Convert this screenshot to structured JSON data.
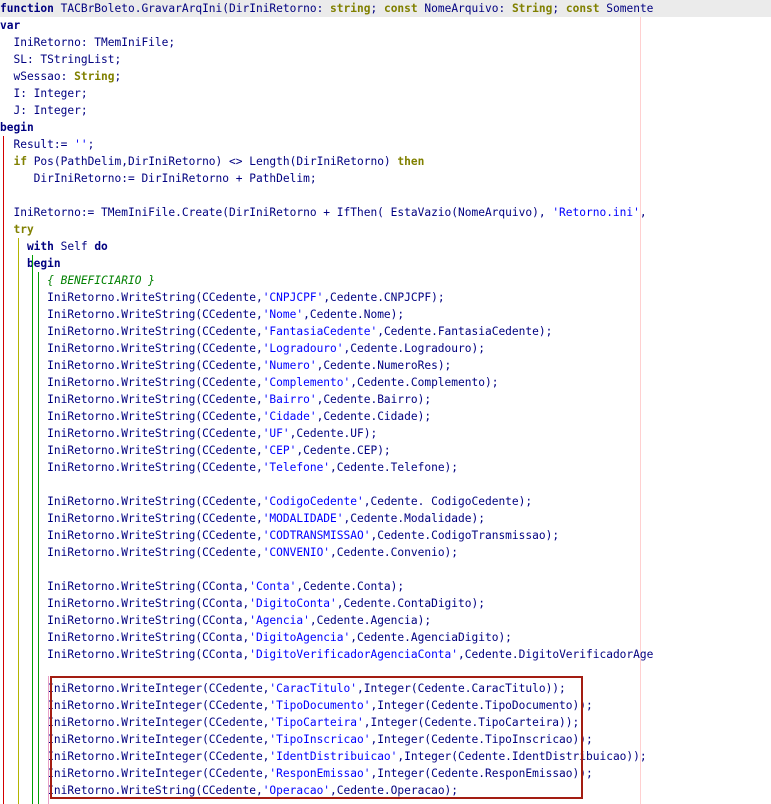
{
  "editor": {
    "lines": [
      {
        "hl": true,
        "tokens": [
          [
            "kw",
            "function"
          ],
          [
            "id",
            " TACBrBoleto.GravarArqIni(DirIniRetorno: "
          ],
          [
            "kw2",
            "string"
          ],
          [
            "id",
            "; "
          ],
          [
            "kw2",
            "const"
          ],
          [
            "id",
            " NomeArquivo: "
          ],
          [
            "kw2",
            "String"
          ],
          [
            "id",
            "; "
          ],
          [
            "kw2",
            "const"
          ],
          [
            "id",
            " Somente"
          ]
        ]
      },
      {
        "tokens": [
          [
            "kw",
            "var"
          ]
        ]
      },
      {
        "tokens": [
          [
            "id",
            "  IniRetorno: TMemIniFile;"
          ]
        ]
      },
      {
        "tokens": [
          [
            "id",
            "  SL: TStringList;"
          ]
        ]
      },
      {
        "tokens": [
          [
            "id",
            "  wSessao: "
          ],
          [
            "kw2",
            "String"
          ],
          [
            "id",
            ";"
          ]
        ]
      },
      {
        "tokens": [
          [
            "id",
            "  I: Integer;"
          ]
        ]
      },
      {
        "tokens": [
          [
            "id",
            "  J: Integer;"
          ]
        ]
      },
      {
        "tokens": [
          [
            "kw",
            "begin"
          ]
        ]
      },
      {
        "tokens": [
          [
            "id",
            "  Result:= "
          ],
          [
            "str",
            "''"
          ],
          [
            "id",
            ";"
          ]
        ]
      },
      {
        "tokens": [
          [
            "kw2",
            "  if"
          ],
          [
            "id",
            " Pos(PathDelim,DirIniRetorno) <> Length(DirIniRetorno) "
          ],
          [
            "kw2",
            "then"
          ]
        ]
      },
      {
        "tokens": [
          [
            "id",
            "     DirIniRetorno:= DirIniRetorno + PathDelim;"
          ]
        ]
      },
      {
        "tokens": [
          [
            "id",
            ""
          ]
        ]
      },
      {
        "tokens": [
          [
            "id",
            "  IniRetorno:= TMemIniFile.Create(DirIniRetorno + IfThen( EstaVazio(NomeArquivo), "
          ],
          [
            "str",
            "'Retorno.ini'"
          ],
          [
            "id",
            ","
          ]
        ]
      },
      {
        "tokens": [
          [
            "kw2",
            "  try"
          ]
        ]
      },
      {
        "tokens": [
          [
            "kw",
            "    with"
          ],
          [
            "id",
            " Self "
          ],
          [
            "kw",
            "do"
          ]
        ]
      },
      {
        "tokens": [
          [
            "kw",
            "    begin"
          ]
        ]
      },
      {
        "tokens": [
          [
            "cmt",
            "       { BENEFICIARIO }"
          ]
        ]
      },
      {
        "tokens": [
          [
            "id",
            "       IniRetorno.WriteString(CCedente,"
          ],
          [
            "str",
            "'CNPJCPF'"
          ],
          [
            "id",
            ",Cedente.CNPJCPF);"
          ]
        ]
      },
      {
        "tokens": [
          [
            "id",
            "       IniRetorno.WriteString(CCedente,"
          ],
          [
            "str",
            "'Nome'"
          ],
          [
            "id",
            ",Cedente.Nome);"
          ]
        ]
      },
      {
        "tokens": [
          [
            "id",
            "       IniRetorno.WriteString(CCedente,"
          ],
          [
            "str",
            "'FantasiaCedente'"
          ],
          [
            "id",
            ",Cedente.FantasiaCedente);"
          ]
        ]
      },
      {
        "tokens": [
          [
            "id",
            "       IniRetorno.WriteString(CCedente,"
          ],
          [
            "str",
            "'Logradouro'"
          ],
          [
            "id",
            ",Cedente.Logradouro);"
          ]
        ]
      },
      {
        "tokens": [
          [
            "id",
            "       IniRetorno.WriteString(CCedente,"
          ],
          [
            "str",
            "'Numero'"
          ],
          [
            "id",
            ",Cedente.NumeroRes);"
          ]
        ]
      },
      {
        "tokens": [
          [
            "id",
            "       IniRetorno.WriteString(CCedente,"
          ],
          [
            "str",
            "'Complemento'"
          ],
          [
            "id",
            ",Cedente.Complemento);"
          ]
        ]
      },
      {
        "tokens": [
          [
            "id",
            "       IniRetorno.WriteString(CCedente,"
          ],
          [
            "str",
            "'Bairro'"
          ],
          [
            "id",
            ",Cedente.Bairro);"
          ]
        ]
      },
      {
        "tokens": [
          [
            "id",
            "       IniRetorno.WriteString(CCedente,"
          ],
          [
            "str",
            "'Cidade'"
          ],
          [
            "id",
            ",Cedente.Cidade);"
          ]
        ]
      },
      {
        "tokens": [
          [
            "id",
            "       IniRetorno.WriteString(CCedente,"
          ],
          [
            "str",
            "'UF'"
          ],
          [
            "id",
            ",Cedente.UF);"
          ]
        ]
      },
      {
        "tokens": [
          [
            "id",
            "       IniRetorno.WriteString(CCedente,"
          ],
          [
            "str",
            "'CEP'"
          ],
          [
            "id",
            ",Cedente.CEP);"
          ]
        ]
      },
      {
        "tokens": [
          [
            "id",
            "       IniRetorno.WriteString(CCedente,"
          ],
          [
            "str",
            "'Telefone'"
          ],
          [
            "id",
            ",Cedente.Telefone);"
          ]
        ]
      },
      {
        "tokens": [
          [
            "id",
            ""
          ]
        ]
      },
      {
        "tokens": [
          [
            "id",
            "       IniRetorno.WriteString(CCedente,"
          ],
          [
            "str",
            "'CodigoCedente'"
          ],
          [
            "id",
            ",Cedente. CodigoCedente);"
          ]
        ]
      },
      {
        "tokens": [
          [
            "id",
            "       IniRetorno.WriteString(CCedente,"
          ],
          [
            "str",
            "'MODALIDADE'"
          ],
          [
            "id",
            ",Cedente.Modalidade);"
          ]
        ]
      },
      {
        "tokens": [
          [
            "id",
            "       IniRetorno.WriteString(CCedente,"
          ],
          [
            "str",
            "'CODTRANSMISSAO'"
          ],
          [
            "id",
            ",Cedente.CodigoTransmissao);"
          ]
        ]
      },
      {
        "tokens": [
          [
            "id",
            "       IniRetorno.WriteString(CCedente,"
          ],
          [
            "str",
            "'CONVENIO'"
          ],
          [
            "id",
            ",Cedente.Convenio);"
          ]
        ]
      },
      {
        "tokens": [
          [
            "id",
            ""
          ]
        ]
      },
      {
        "tokens": [
          [
            "id",
            "       IniRetorno.WriteString(CConta,"
          ],
          [
            "str",
            "'Conta'"
          ],
          [
            "id",
            ",Cedente.Conta);"
          ]
        ]
      },
      {
        "tokens": [
          [
            "id",
            "       IniRetorno.WriteString(CConta,"
          ],
          [
            "str",
            "'DigitoConta'"
          ],
          [
            "id",
            ",Cedente.ContaDigito);"
          ]
        ]
      },
      {
        "tokens": [
          [
            "id",
            "       IniRetorno.WriteString(CConta,"
          ],
          [
            "str",
            "'Agencia'"
          ],
          [
            "id",
            ",Cedente.Agencia);"
          ]
        ]
      },
      {
        "tokens": [
          [
            "id",
            "       IniRetorno.WriteString(CConta,"
          ],
          [
            "str",
            "'DigitoAgencia'"
          ],
          [
            "id",
            ",Cedente.AgenciaDigito);"
          ]
        ]
      },
      {
        "tokens": [
          [
            "id",
            "       IniRetorno.WriteString(CConta,"
          ],
          [
            "str",
            "'DigitoVerificadorAgenciaConta'"
          ],
          [
            "id",
            ",Cedente.DigitoVerificadorAge"
          ]
        ]
      },
      {
        "tokens": [
          [
            "id",
            ""
          ]
        ]
      },
      {
        "tokens": [
          [
            "id",
            "       IniRetorno.WriteInteger(CCedente,"
          ],
          [
            "str",
            "'CaracTitulo'"
          ],
          [
            "id",
            ",Integer(Cedente.CaracTitulo));"
          ]
        ]
      },
      {
        "tokens": [
          [
            "id",
            "       IniRetorno.WriteInteger(CCedente,"
          ],
          [
            "str",
            "'TipoDocumento'"
          ],
          [
            "id",
            ",Integer(Cedente.TipoDocumento));"
          ]
        ]
      },
      {
        "tokens": [
          [
            "id",
            "       IniRetorno.WriteInteger(CCedente,"
          ],
          [
            "str",
            "'TipoCarteira'"
          ],
          [
            "id",
            ",Integer(Cedente.TipoCarteira));"
          ]
        ]
      },
      {
        "tokens": [
          [
            "id",
            "       IniRetorno.WriteInteger(CCedente,"
          ],
          [
            "str",
            "'TipoInscricao'"
          ],
          [
            "id",
            ",Integer(Cedente.TipoInscricao));"
          ]
        ]
      },
      {
        "tokens": [
          [
            "id",
            "       IniRetorno.WriteInteger(CCedente,"
          ],
          [
            "str",
            "'IdentDistribuicao'"
          ],
          [
            "id",
            ",Integer(Cedente.IdentDistribuicao));"
          ]
        ]
      },
      {
        "tokens": [
          [
            "id",
            "       IniRetorno.WriteInteger(CCedente,"
          ],
          [
            "str",
            "'ResponEmissao'"
          ],
          [
            "id",
            ",Integer(Cedente.ResponEmissao));"
          ]
        ]
      },
      {
        "tokens": [
          [
            "id",
            "       IniRetorno.WriteString(CCedente,"
          ],
          [
            "str",
            "'Operacao'"
          ],
          [
            "id",
            ",Cedente.Operacao);"
          ]
        ]
      }
    ]
  },
  "colors": {
    "keyword": "#000080",
    "keyword_alt": "#808000",
    "string": "#0000ff",
    "comment": "#008000",
    "highlight_box": "#a31d12",
    "current_line": "#ebebeb"
  }
}
